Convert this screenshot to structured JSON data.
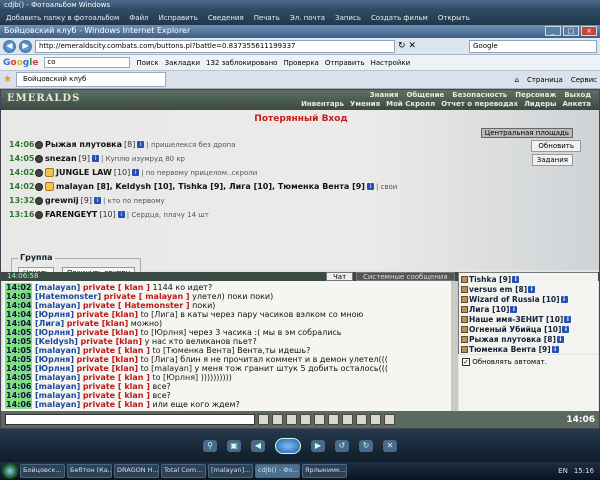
{
  "photo_viewer": {
    "title": "cdjb() - Фотоальбом Windows",
    "menu": [
      "Добавить папку в фотоальбом",
      "Файл",
      "Исправить",
      "Сведения",
      "Печать",
      "Эл. почта",
      "Запись",
      "Создать фильм",
      "Открыть"
    ]
  },
  "ie": {
    "title": "Бойцовский клуб - Windows Internet Explorer",
    "url": "http://emeraldscity.combats.com/buttons.pl?battle=0.837355611199337",
    "search_placeholder": "Google",
    "google_bar": {
      "search_value": "co",
      "items": [
        "Поиск",
        "Закладки",
        "132 заблокировано",
        "Проверка",
        "Отправить",
        "Настройки"
      ]
    },
    "tab_label": "Бойцовский клуб",
    "tab_tools": [
      "Страница",
      "Сервис"
    ]
  },
  "game": {
    "logo": "EMERALDS",
    "nav_top": [
      "Знания",
      "Общение",
      "Безопасность",
      "Персонаж",
      "Выход"
    ],
    "nav_bottom": [
      "Инвентарь",
      "Умения",
      "Мой Скролл",
      "Отчет о переводах",
      "Лидеры",
      "Анкета"
    ],
    "location_title": "Потерянный Вход",
    "location_name": "Центральная площадь",
    "refresh_label": "Обновить",
    "tasks_label": "Задания",
    "players": [
      {
        "time": "14:06",
        "name": "Рыжая плутовка",
        "level": "[8]",
        "status": "| пришелекся без дропа"
      },
      {
        "time": "14:05",
        "name": "snezan",
        "level": "[9]",
        "status": "| Куплю изумруд 80 кр"
      },
      {
        "time": "14:02",
        "name": "JUNGLE LAW",
        "level": "[10]",
        "status": "| по первому прицелом..скроли"
      },
      {
        "time": "14:02",
        "name": "malayan [8], Keldysh [10], Tishka [9], Лига [10], Тюменка Вента [9]",
        "level": "",
        "status": "| свои"
      },
      {
        "time": "13:32",
        "name": "grewnij",
        "level": "[9]",
        "status": "| кто по первому"
      },
      {
        "time": "13:16",
        "name": "FARENGEYT",
        "level": "[10]",
        "status": "| Сердца, плачу 14 шт"
      }
    ],
    "group": {
      "label": "Группа",
      "start": "Начать",
      "leave": "Покинуть группу"
    },
    "chat_tabs": {
      "time": "14:06:58",
      "chat": "Чат",
      "system": "Системные сообщения"
    },
    "chat": [
      {
        "t": "14:02",
        "n": "[malayan]",
        "p": "private [ klan ]",
        "to": "",
        "m": "1144 ко идет?"
      },
      {
        "t": "14:03",
        "n": "[Hatemonster]",
        "p": "private [ malayan ]",
        "to": "",
        "m": "улетел) поки поки)"
      },
      {
        "t": "14:04",
        "n": "[malayan]",
        "p": "private [ Hatemonster ]",
        "to": "",
        "m": "поки)"
      },
      {
        "t": "14:04",
        "n": "[Юрлня]",
        "p": "private [klan]",
        "to": "to [Лига]",
        "m": "в каты через пару часиков вэлком со мною"
      },
      {
        "t": "14:04",
        "n": "[Лига]",
        "p": "private [klan]",
        "to": "",
        "m": "можно)"
      },
      {
        "t": "14:05",
        "n": "[Юрлня]",
        "p": "private [klan]",
        "to": "to [Юрлня]",
        "m": "через 3 часика :( мы в эм собрались"
      },
      {
        "t": "14:05",
        "n": "[Keldysh]",
        "p": "private [klan]",
        "to": "",
        "m": "у нас кто великанов пьет?"
      },
      {
        "t": "14:05",
        "n": "[malayan]",
        "p": "private [ klan ]",
        "to": "to [Тюменка Вента]",
        "m": "Вента,ты идешь?"
      },
      {
        "t": "14:05",
        "n": "[Юрлня]",
        "p": "private [klan]",
        "to": "to [Лига]",
        "m": "блин я не прочитал коммент и в демон улетел((("
      },
      {
        "t": "14:05",
        "n": "[Юрлня]",
        "p": "private [klan]",
        "to": "to [malayan]",
        "m": "у меня тож гранит штук 5 добить осталось((("
      },
      {
        "t": "14:05",
        "n": "[malayan]",
        "p": "private [ klan ]",
        "to": "to [Юрлня]",
        "m": "))))))))))"
      },
      {
        "t": "14:06",
        "n": "[malayan]",
        "p": "private [ klan ]",
        "to": "",
        "m": "все?"
      },
      {
        "t": "14:06",
        "n": "[malayan]",
        "p": "private [ klan ]",
        "to": "",
        "m": "все?"
      },
      {
        "t": "14:06",
        "n": "[malayan]",
        "p": "private [ klan ]",
        "to": "",
        "m": "или еще кого ждем?"
      }
    ],
    "player_list": [
      "Tishka [9]",
      "versus em [8]",
      "Wizard of Russia [10]",
      "Лига [10]",
      "Наше имя-ЗЕНИТ [10]",
      "Огненый Убийца [10]",
      "Рыжая плутовка [8]",
      "Тюменка Вента [9]"
    ],
    "auto_update": "Обновлять автомат.",
    "clock": "14:06"
  },
  "taskbar": {
    "items": [
      "Бойцовск...",
      "Бебтон (Ка...",
      "DRAGON H...",
      "Total Com...",
      "[malayan]...",
      "cdjb() - Фо...",
      "Ярлыкимк..."
    ],
    "lang": "EN",
    "time": "15:16"
  }
}
